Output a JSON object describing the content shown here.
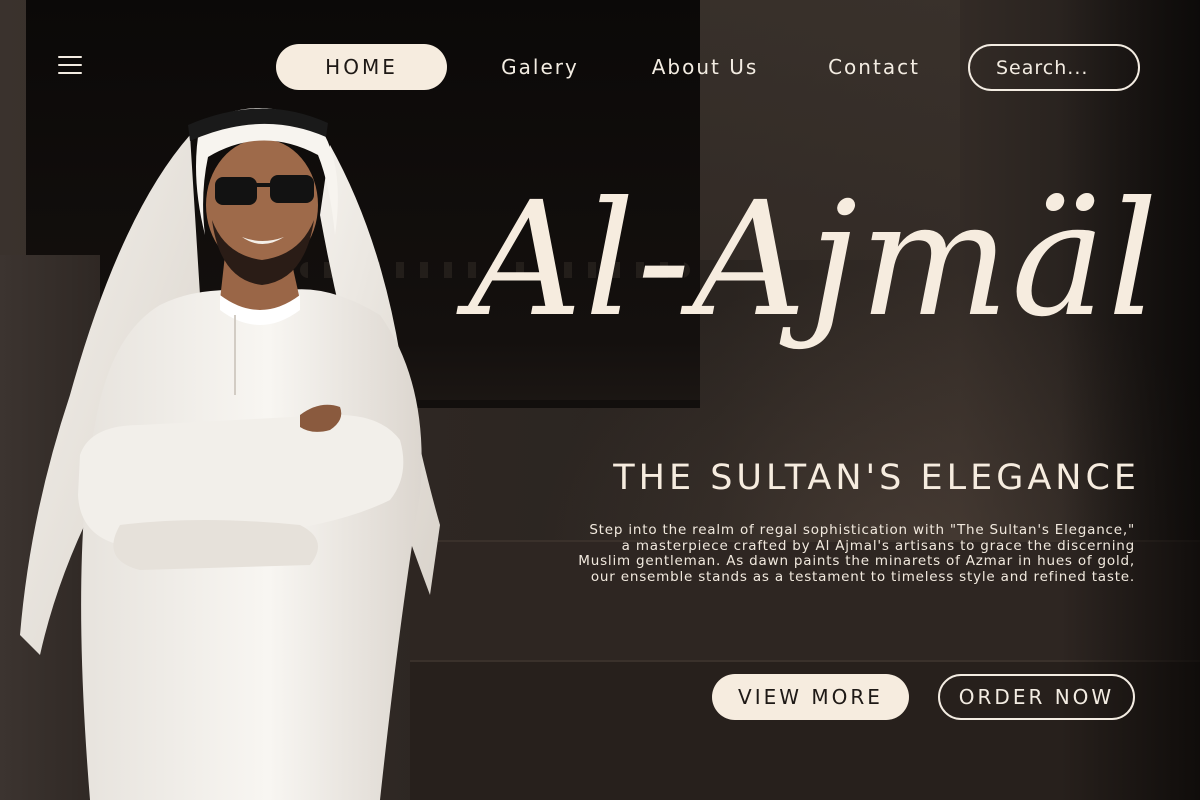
{
  "nav": {
    "menu_icon": "hamburger-menu-icon",
    "links": [
      "HOME",
      "Galery",
      "About Us",
      "Contact"
    ],
    "active": "HOME",
    "search_placeholder": "Search..."
  },
  "hero": {
    "brand": "Al-Ajmäl",
    "tagline": "THE SULTAN'S ELEGANCE",
    "description": "Step into the realm of regal sophistication with \"The Sultan's Elegance,\" a masterpiece crafted by Al Ajmal's artisans to grace the discerning Muslim gentleman. As dawn paints the minarets of Azmar in hues of gold, our ensemble stands as a testament to timeless style and refined taste.",
    "view_more_label": "VIEW MORE",
    "order_now_label": "ORDER NOW"
  },
  "colors": {
    "cream": "#f6ecdf",
    "background": "#2a2420",
    "text_dark": "#1e1916"
  }
}
